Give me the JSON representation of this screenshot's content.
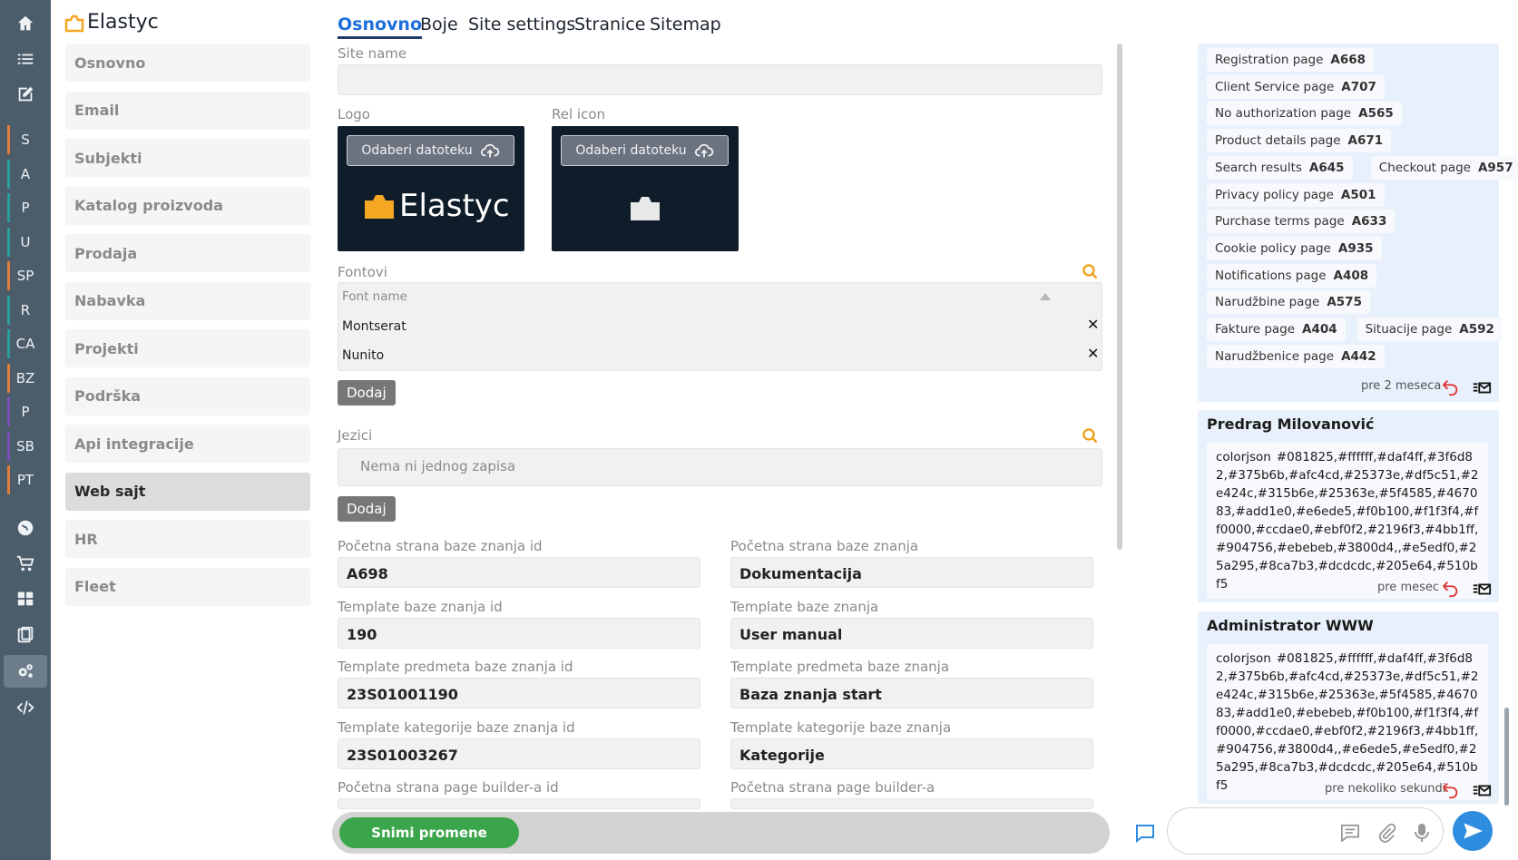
{
  "app": {
    "name": "Elastyc"
  },
  "rail": {
    "icons": [
      "home-icon",
      "list-icon",
      "edit-icon",
      "globe-icon",
      "cart-icon",
      "grid-icon",
      "clipboard-icon",
      "settings-icon",
      "code-icon"
    ],
    "modules": [
      {
        "label": "S",
        "color": "#e07b39"
      },
      {
        "label": "A",
        "color": "#2d9c9c"
      },
      {
        "label": "P",
        "color": "#2d9c9c"
      },
      {
        "label": "U",
        "color": "#2d9c9c"
      },
      {
        "label": "SP",
        "color": "#e07b39"
      },
      {
        "label": "R",
        "color": "#2d9c9c"
      },
      {
        "label": "CA",
        "color": "#2d9c9c"
      },
      {
        "label": "BZ",
        "color": "#e07b39"
      },
      {
        "label": "P",
        "color": "#7b4fb5"
      },
      {
        "label": "SB",
        "color": "#7b4fb5"
      },
      {
        "label": "PT",
        "color": "#e07b39"
      }
    ]
  },
  "menu": {
    "items": [
      "Osnovno",
      "Email",
      "Subjekti",
      "Katalog proizvoda",
      "Prodaja",
      "Nabavka",
      "Projekti",
      "Podrška",
      "Api integracije",
      "Web sajt",
      "HR",
      "Fleet"
    ],
    "active": "Web sajt"
  },
  "tabs": [
    "Osnovno",
    "Boje",
    "Site settings",
    "Stranice",
    "Sitemap"
  ],
  "form": {
    "site_name_label": "Site name",
    "site_name_value": "",
    "logo_label": "Logo",
    "rel_icon_label": "Rel icon",
    "upload_label": "Odaberi datoteku",
    "logo_preview_text": "Elastyc",
    "fonts_label": "Fontovi",
    "font_name_header": "Font name",
    "fonts": [
      "Montserat",
      "Nunito"
    ],
    "add_label": "Dodaj",
    "languages_label": "Jezici",
    "languages_empty": "Nema ni jednog zapisa",
    "fields": [
      {
        "label": "Početna strana baze znanja id",
        "value": "A698"
      },
      {
        "label": "Početna strana baze znanja",
        "value": "Dokumentacija"
      },
      {
        "label": "Template baze znanja id",
        "value": "190"
      },
      {
        "label": "Template baze znanja",
        "value": "User manual"
      },
      {
        "label": "Template predmeta baze znanja id",
        "value": "23S01001190"
      },
      {
        "label": "Template predmeta baze znanja",
        "value": "Baza znanja start"
      },
      {
        "label": "Template kategorije baze znanja id",
        "value": "23S01003267"
      },
      {
        "label": "Template kategorije baze znanja",
        "value": "Kategorije"
      },
      {
        "label": "Početna strana page builder-a id",
        "value": ""
      },
      {
        "label": "Početna strana page builder-a",
        "value": ""
      }
    ],
    "save_label": "Snimi promene"
  },
  "chat": {
    "chips": [
      {
        "name": "Registration page",
        "code": "A668"
      },
      {
        "name": "Client Service page",
        "code": "A707"
      },
      {
        "name": "No authorization page",
        "code": "A565"
      },
      {
        "name": "Product details page",
        "code": "A671"
      },
      {
        "name": "Search results",
        "code": "A645"
      },
      {
        "name": "Checkout page",
        "code": "A957"
      },
      {
        "name": "Privacy policy page",
        "code": "A501"
      },
      {
        "name": "Purchase terms page",
        "code": "A633"
      },
      {
        "name": "Cookie policy page",
        "code": "A935"
      },
      {
        "name": "Notifications page",
        "code": "A408"
      },
      {
        "name": "Narudžbine page",
        "code": "A575"
      },
      {
        "name": "Fakture page",
        "code": "A404"
      },
      {
        "name": "Situacije page",
        "code": "A592"
      },
      {
        "name": "Narudžbenice page",
        "code": "A442"
      }
    ],
    "first_time": "pre 2 meseca",
    "messages": [
      {
        "author": "Predrag Milovanović",
        "key": "colorjson",
        "value": "#081825,#ffffff,#daf4ff,#3f6d82,#375b6b,#afc4cd,#25373e,#df5c51,#2e424c,#315b6e,#25363e,#5f4585,#467083,#add1e0,#e6ede5,#f0b100,#f1f3f4,#ff0000,#ccdae0,#ebf0f2,#2196f3,#4bb1ff,#904756,#ebebeb,#3800d4,,#e5edf0,#25a295,#8ca7b3,#dcdcdc,#205e64,#510bf5",
        "time": "pre mesec"
      },
      {
        "author": "Administrator WWW",
        "key": "colorjson",
        "value": "#081825,#ffffff,#daf4ff,#3f6d82,#375b6b,#afc4cd,#25373e,#df5c51,#2e424c,#315b6e,#25363e,#5f4585,#467083,#add1e0,#ebebeb,#f0b100,#f1f3f4,#ff0000,#ccdae0,#ebf0f2,#2196f3,#4bb1ff,#904756,#3800d4,,#e6ede5,#e5edf0,#25a295,#8ca7b3,#dcdcdc,#205e64,#510bf5",
        "time": "pre nekoliko sekundi"
      }
    ]
  },
  "colors": {
    "accent": "#1e6fd9",
    "save": "#3aa54b",
    "logo_orange": "#f5a623",
    "rail": "#4b5c6b"
  }
}
